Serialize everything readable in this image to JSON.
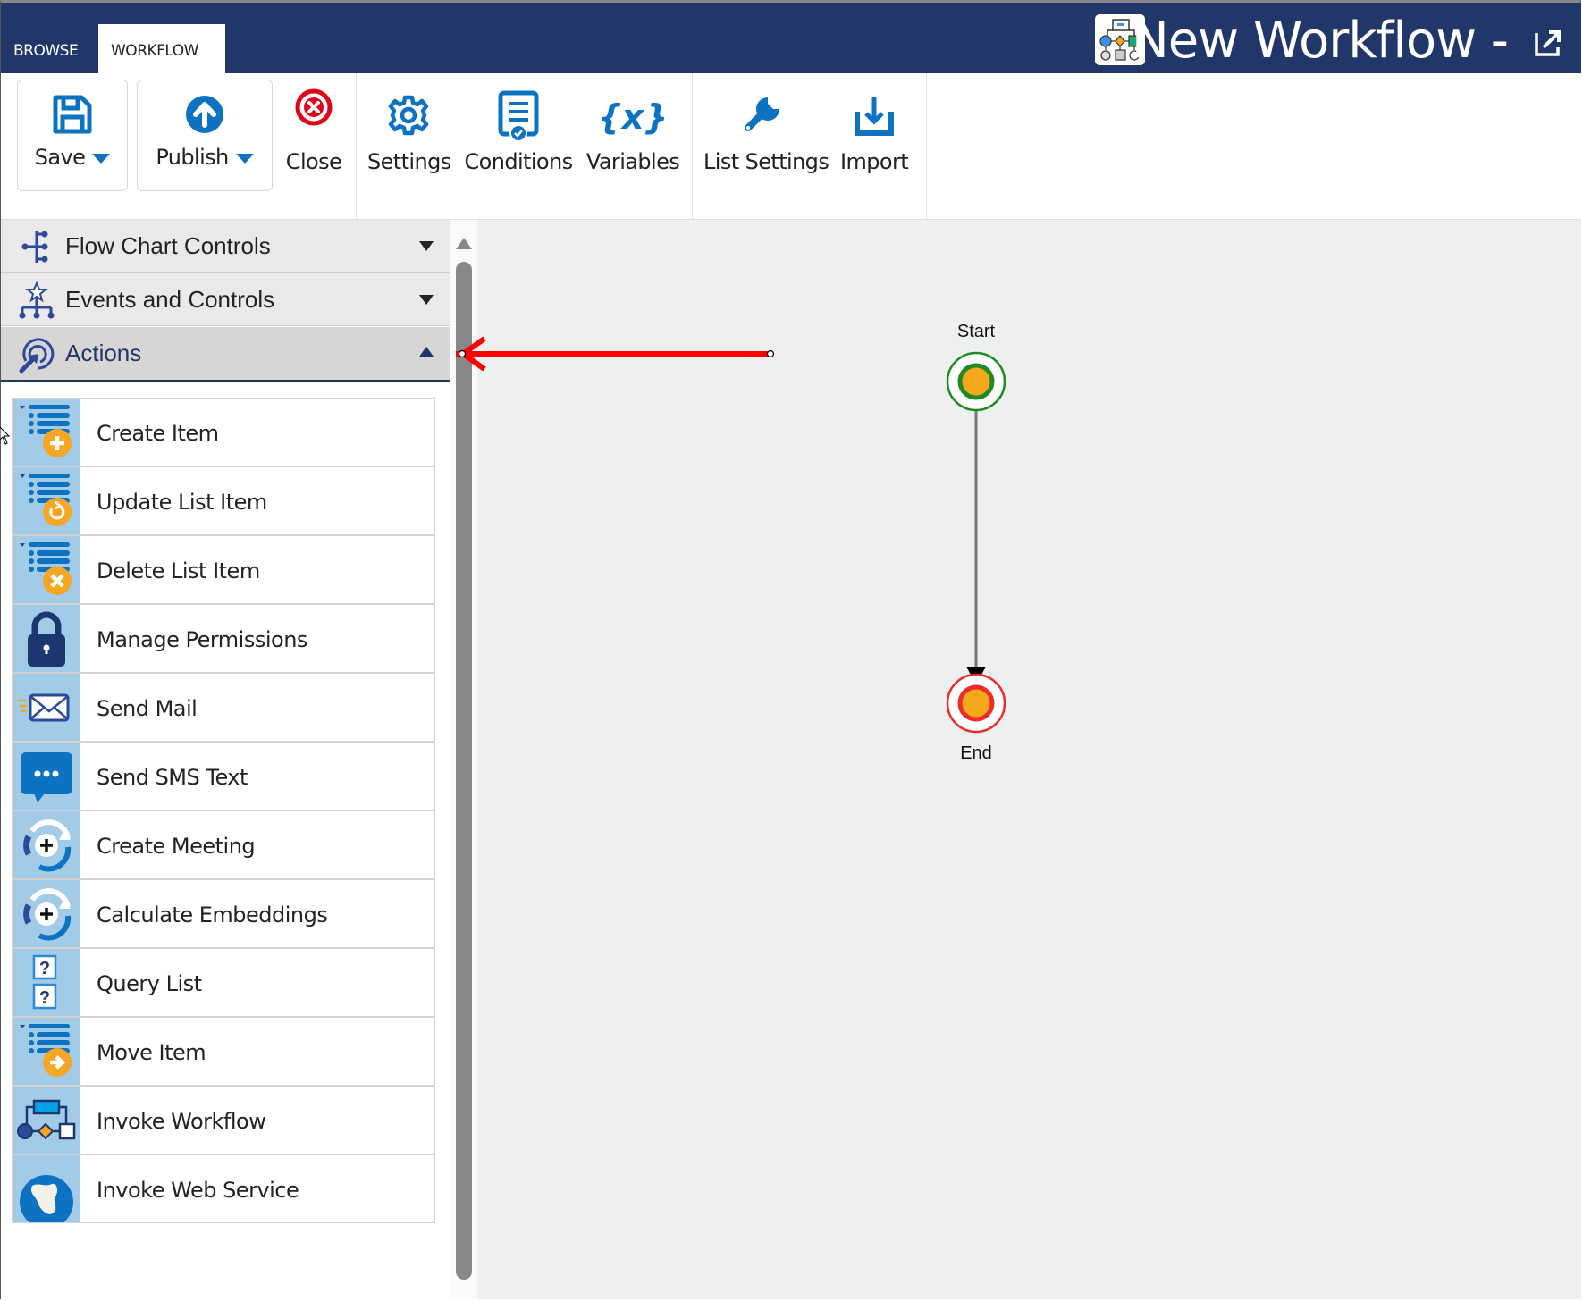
{
  "header": {
    "tabs": [
      {
        "label": "BROWSE",
        "active": false
      },
      {
        "label": "WORKFLOW",
        "active": true
      }
    ],
    "title": "New Workflow -",
    "title_icon": "workflow-diagram-icon",
    "popout_icon": "popout-icon",
    "color": "#213669"
  },
  "ribbon": {
    "buttons": [
      {
        "label": "Save",
        "icon": "floppy-disk-icon",
        "has_dropdown": true
      },
      {
        "label": "Publish",
        "icon": "upload-arrow-icon",
        "has_dropdown": true
      },
      {
        "label": "Close",
        "icon": "close-circle-icon",
        "has_dropdown": false
      },
      {
        "label": "Settings",
        "icon": "gear-icon",
        "has_dropdown": false
      },
      {
        "label": "Conditions",
        "icon": "checklist-icon",
        "has_dropdown": false
      },
      {
        "label": "Variables",
        "icon": "variable-braces-icon",
        "has_dropdown": false
      },
      {
        "label": "List Settings",
        "icon": "wrench-icon",
        "has_dropdown": false
      },
      {
        "label": "Import",
        "icon": "import-icon",
        "has_dropdown": false
      }
    ],
    "accent": "#0d72c2"
  },
  "sidebar": {
    "sections": [
      {
        "label": "Flow Chart Controls",
        "icon": "flowchart-branch-icon",
        "expanded": false
      },
      {
        "label": "Events and Controls",
        "icon": "event-hierarchy-icon",
        "expanded": false
      },
      {
        "label": "Actions",
        "icon": "action-target-icon",
        "expanded": true
      }
    ],
    "actions": [
      {
        "label": "Create Item",
        "icon": "list-add-icon"
      },
      {
        "label": "Update List Item",
        "icon": "list-refresh-icon"
      },
      {
        "label": "Delete List Item",
        "icon": "list-delete-icon"
      },
      {
        "label": "Manage Permissions",
        "icon": "lock-icon"
      },
      {
        "label": "Send Mail",
        "icon": "envelope-icon"
      },
      {
        "label": "Send SMS Text",
        "icon": "chat-bubble-icon"
      },
      {
        "label": "Create Meeting",
        "icon": "cycle-plus-icon"
      },
      {
        "label": "Calculate Embeddings",
        "icon": "cycle-plus-icon"
      },
      {
        "label": "Query List",
        "icon": "question-boxes-icon"
      },
      {
        "label": "Move Item",
        "icon": "list-move-icon"
      },
      {
        "label": "Invoke Workflow",
        "icon": "workflow-diagram-icon"
      },
      {
        "label": "Invoke Web Service",
        "icon": "globe-icon"
      }
    ]
  },
  "canvas": {
    "nodes": [
      {
        "label": "Start",
        "type": "start",
        "ring_color": "#1f8a1f"
      },
      {
        "label": "End",
        "type": "end",
        "ring_color": "#ee2a2a"
      }
    ],
    "connector": {
      "from": "Start",
      "to": "End"
    },
    "annotation_arrow": {
      "color": "#ff0000",
      "points_to": "sidebar-scrollbar"
    },
    "background": "#eef0ef"
  }
}
